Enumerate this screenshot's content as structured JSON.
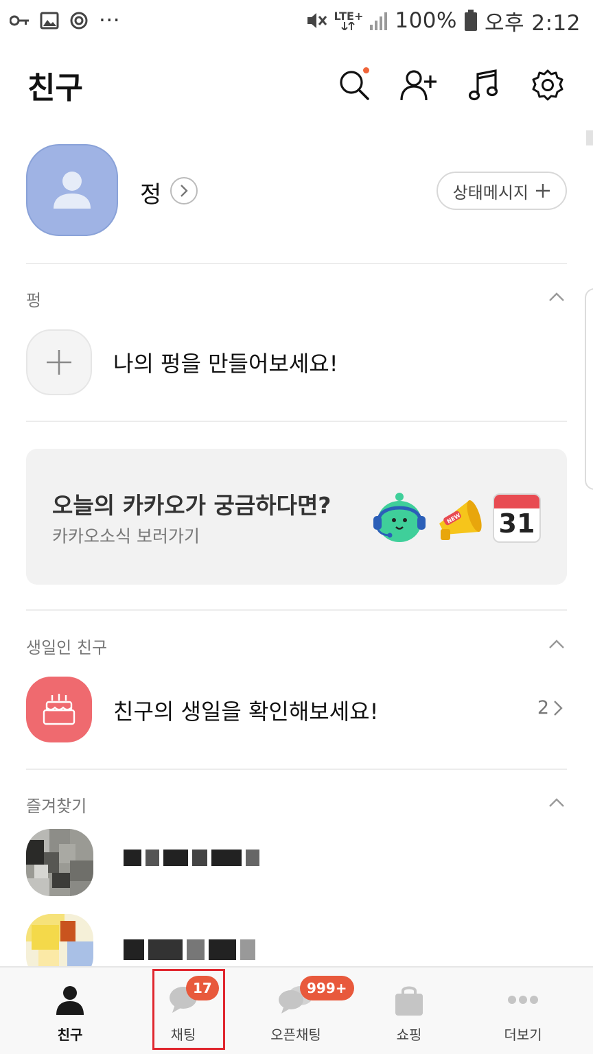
{
  "status_bar": {
    "battery": "100%",
    "time": "오후 2:12",
    "network": "LTE+",
    "more": "···"
  },
  "header": {
    "title": "친구"
  },
  "profile": {
    "name": "정",
    "status_button": "상태메시지"
  },
  "pyeong_section": {
    "title": "펑",
    "prompt": "나의 펑을 만들어보세요!"
  },
  "banner": {
    "title": "오늘의 카카오가 궁금하다면?",
    "subtitle": "카카오소식 보러가기",
    "calendar_day": "31",
    "new_tag": "NEW"
  },
  "birthday_section": {
    "title": "생일인 친구",
    "prompt": "친구의 생일을 확인해보세요!",
    "count": "2"
  },
  "favorites_section": {
    "title": "즐겨찾기"
  },
  "tabbar": {
    "tabs": [
      {
        "label": "친구",
        "badge": ""
      },
      {
        "label": "채팅",
        "badge": "17"
      },
      {
        "label": "오픈채팅",
        "badge": "999+"
      },
      {
        "label": "쇼핑",
        "badge": ""
      },
      {
        "label": "더보기",
        "badge": ""
      }
    ]
  },
  "colors": {
    "badge": "#e8593c",
    "avatar": "#9fb3e4",
    "birthday": "#ef6a6f",
    "highlight": "#e0262e"
  }
}
